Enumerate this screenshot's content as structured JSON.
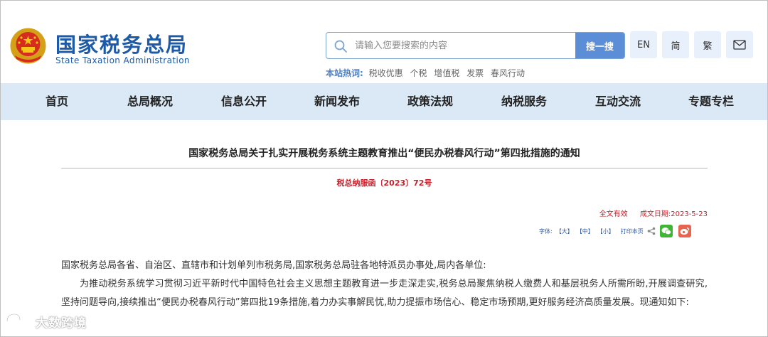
{
  "header": {
    "logo_cn": "国家税务总局",
    "logo_en": "State Taxation Administration",
    "search": {
      "placeholder": "请输入您要搜索的内容",
      "button_label": "搜一搜"
    },
    "hot": {
      "label": "本站热词:",
      "items": [
        "税收优惠",
        "个税",
        "增值税",
        "发票",
        "春风行动"
      ]
    },
    "utils": {
      "english": "EN",
      "simplified": "简",
      "traditional": "繁",
      "mail_icon": "mail-icon"
    }
  },
  "nav": {
    "items": [
      "首页",
      "总局概况",
      "信息公开",
      "新闻发布",
      "政策法规",
      "纳税服务",
      "互动交流",
      "专题专栏"
    ]
  },
  "article": {
    "title": "国家税务总局关于扎实开展税务系统主题教育推出“便民办税春风行动”第四批措施的通知",
    "doc_number": "税总纳服函〔2023〕72号",
    "validity": "全文有效",
    "date": "成文日期:2023-5-23",
    "tools": {
      "font_label": "字体:",
      "large": "【大】",
      "medium": "【中】",
      "small": "【小】",
      "print": "打印本页"
    },
    "paragraph1": "国家税务总局各省、自治区、直辖市和计划单列市税务局,国家税务总局驻各地特派员办事处,局内各单位:",
    "paragraph2": "为推动税务系统学习贯彻习近平新时代中国特色社会主义思想主题教育进一步走深走实,税务总局聚焦纳税人缴费人和基层税务人所需所盼,开展调查研究,坚持问题导向,接续推出“便民办税春风行动”第四批19条措施,着力办实事解民忧,助力提振市场信心、稳定市场预期,更好服务经济高质量发展。现通知如下:"
  },
  "watermark": {
    "text": "大数跨境"
  },
  "colors": {
    "brand_blue": "#1d5aa8",
    "nav_bg": "#dbe9f7",
    "search_button": "#5b8ed6",
    "accent_red": "#c8202a",
    "wechat_green": "#3fb435",
    "weibo_red": "#e8644f"
  }
}
